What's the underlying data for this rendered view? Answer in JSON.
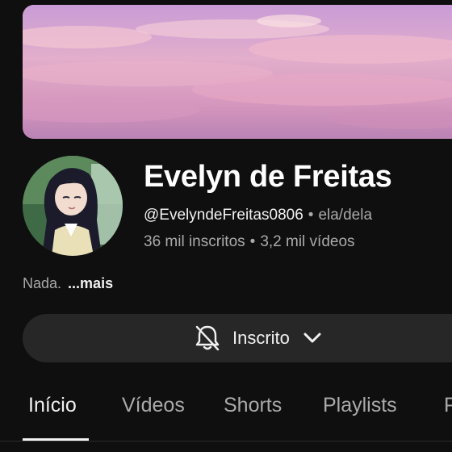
{
  "channel": {
    "name": "Evelyn de Freitas",
    "handle": "@EvelyndeFreitas0806",
    "pronouns": "ela/dela",
    "subscribers": "36 mil inscritos",
    "videos": "3,2 mil vídeos",
    "separator": "•"
  },
  "description": {
    "text": "Nada.",
    "more_label": "...mais"
  },
  "subscribe_button": {
    "label": "Inscrito",
    "icon": "bell-off-icon",
    "dropdown_icon": "chevron-down-icon"
  },
  "tabs": [
    {
      "label": "Início",
      "active": true
    },
    {
      "label": "Vídeos",
      "active": false
    },
    {
      "label": "Shorts",
      "active": false
    },
    {
      "label": "Playlists",
      "active": false
    },
    {
      "label": "P",
      "active": false
    }
  ],
  "colors": {
    "background": "#0f0f0f",
    "button_bg": "#272727",
    "text_primary": "#f1f1f1",
    "text_secondary": "#aaaaaa"
  }
}
